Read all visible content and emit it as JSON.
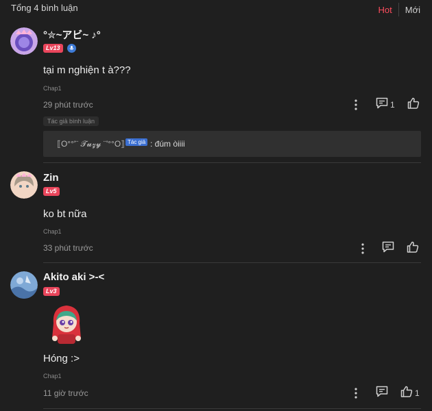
{
  "header": {
    "total_label": "Tổng 4 bình luận",
    "sort_hot": "Hot",
    "sort_new": "Mới"
  },
  "comments": [
    {
      "user": "°✮~アビ~ ♪°",
      "level": "Lv13",
      "text": "tại m nghiện t à???",
      "chapter": "Chap1",
      "time": "29 phút trước",
      "reply_count": "1",
      "author_tag": "Tác giả bình luận",
      "reply": {
        "user": "⟦O°°'¨ 𝓣𝓾𝔃𝔂 ¨'°°O⟧",
        "tag": "Tác giả",
        "text": ": đúm òiiii"
      }
    },
    {
      "user": "Zin",
      "level": "Lv5",
      "text": "ko bt nữa",
      "chapter": "Chap1",
      "time": "33 phút trước"
    },
    {
      "user": "Akito aki >-<",
      "level": "Lv3",
      "text": "Hóng :>",
      "chapter": "Chap1",
      "time": "11 giờ trước",
      "like_count": "1"
    }
  ],
  "colors": {
    "background": "#1f1f1f",
    "accent": "#ff4d5e",
    "level_badge": "#e9455b",
    "author_tag": "#3b6fd1"
  }
}
